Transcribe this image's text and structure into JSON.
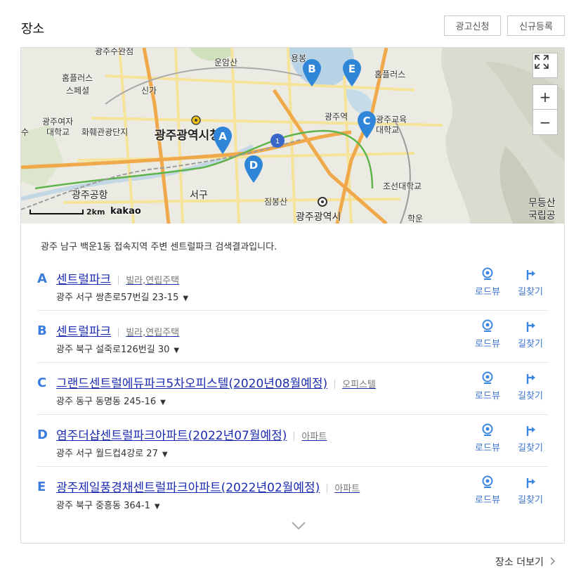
{
  "header": {
    "title": "장소",
    "ad_button": "광고신청",
    "register_button": "신규등록"
  },
  "map": {
    "labels": {
      "l1": "광주수완점",
      "l2": "운암산",
      "l3": "용봉",
      "l4": "홈플러스",
      "l5": "스페셜",
      "l6": "신가",
      "l7": "홈플러스",
      "l8": "광주여자",
      "l9": "대학교",
      "l10": "화훼관광단지",
      "l11": "광주광역시청",
      "l12": "광주역",
      "l13": "광주교육",
      "l14": "대학교",
      "l15": "조선대학교",
      "l16": "광주공항",
      "l17": "서구",
      "l18": "짐봉산",
      "l19": "광주광역시",
      "l20": "무등산",
      "l21": "국립공",
      "l22": "학운",
      "l23": "수"
    },
    "scale": "2km",
    "brand": "kakao",
    "markers": [
      "A",
      "B",
      "C",
      "D",
      "E"
    ],
    "zoom_in": "+",
    "zoom_out": "−"
  },
  "result_desc": "광주 남구 백운1동 접속지역 주변 센트럴파크 검색결과입니다.",
  "actions": {
    "roadview": "로드뷰",
    "directions": "길찾기"
  },
  "results": [
    {
      "letter": "A",
      "name": "센트럴파크",
      "category": "빌라,연립주택",
      "address": "광주 서구 쌍촌로57번길 23-15"
    },
    {
      "letter": "B",
      "name": "센트럴파크",
      "category": "빌라,연립주택",
      "address": "광주 북구 설죽로126번길 30"
    },
    {
      "letter": "C",
      "name": "그랜드센트럴에듀파크5차오피스텔(2020년08월예정)",
      "category": "오피스텔",
      "address": "광주 동구 동명동 245-16"
    },
    {
      "letter": "D",
      "name": "염주더샵센트럴파크아파트(2022년07월예정)",
      "category": "아파트",
      "address": "광주 서구 월드컵4강로 27"
    },
    {
      "letter": "E",
      "name": "광주제일풍경채센트럴파크아파트(2022년02월예정)",
      "category": "아파트",
      "address": "광주 북구 중흥동 364-1"
    }
  ],
  "more_link": "장소 더보기",
  "colors": {
    "accent": "#3a7be0",
    "link": "#1c2cb0",
    "marker": "#2f86d8"
  }
}
